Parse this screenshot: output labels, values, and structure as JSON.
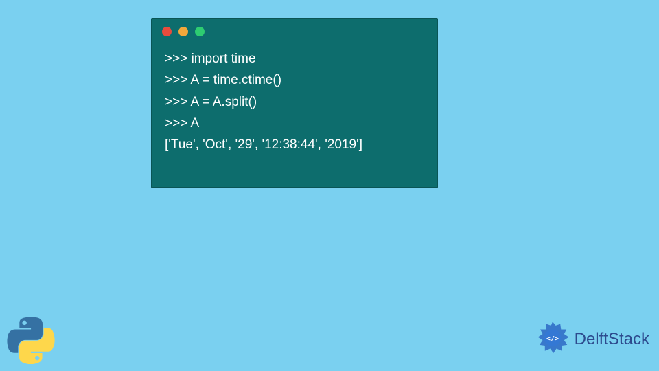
{
  "terminal": {
    "lines": [
      ">>> import time",
      ">>> A = time.ctime()",
      ">>> A = A.split()",
      ">>> A",
      "['Tue', 'Oct', '29', '12:38:44', '2019']"
    ]
  },
  "branding": {
    "name": "DelftStack"
  },
  "colors": {
    "background": "#7AD0F0",
    "terminal_bg": "#0D6D6D",
    "terminal_border": "#0A5555",
    "dot_red": "#E84C3D",
    "dot_yellow": "#F2A83B",
    "dot_green": "#2ECC71",
    "code_text": "#FFFFFF",
    "brand_text": "#2D4B8E"
  }
}
